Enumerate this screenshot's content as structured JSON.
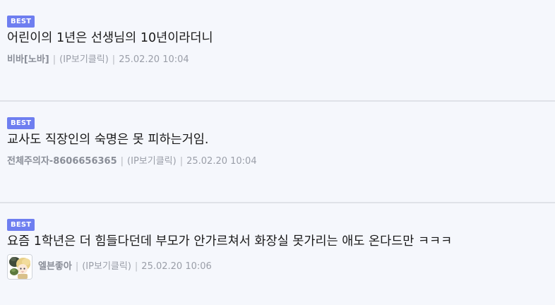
{
  "comments": [
    {
      "badge": "BEST",
      "text": "어린이의 1년은 선생님의 10년이라더니",
      "author": "비바[노바]",
      "ip": "(IP보기클릭)",
      "date": "25.02.20 10:04",
      "separator": "|",
      "has_avatar": false
    },
    {
      "badge": "BEST",
      "text": "교사도 직장인의 숙명은 못 피하는거임.",
      "author": "전체주의자-8606656365",
      "ip": "(IP보기클릭)",
      "date": "25.02.20 10:04",
      "separator": "|",
      "has_avatar": false
    },
    {
      "badge": "BEST",
      "text": "요즘 1학년은 더 힘들다던데 부모가 안가르쳐서 화장실 못가리는 애도 온다드만 ㅋㅋㅋ",
      "author": "엘븐좋아",
      "ip": "(IP보기클릭)",
      "date": "25.02.20 10:06",
      "separator": "|",
      "has_avatar": true,
      "avatar_icon": "anime-character-avatar"
    }
  ],
  "colors": {
    "badge_bg": "#6e7ef0",
    "background": "#f5f7fc",
    "divider": "#dfe2e8",
    "meta_text": "#9a9ea8"
  }
}
